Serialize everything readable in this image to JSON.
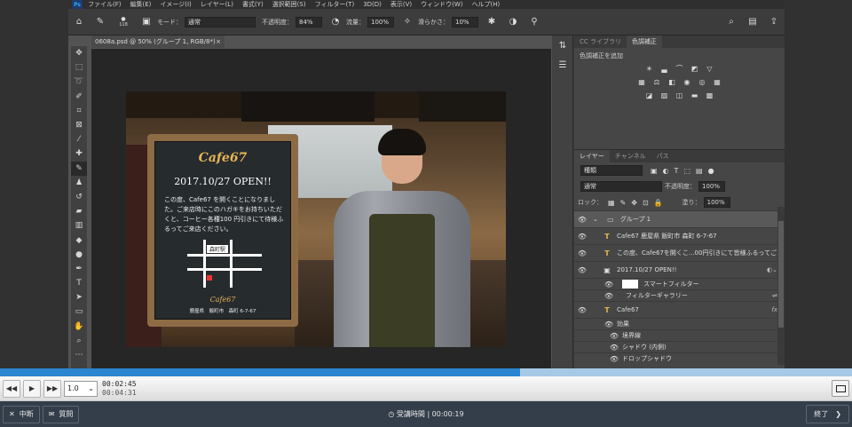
{
  "menu": [
    "ファイル(F)",
    "編集(E)",
    "イメージ(I)",
    "レイヤー(L)",
    "書式(Y)",
    "選択範囲(S)",
    "フィルター(T)",
    "3D(D)",
    "表示(V)",
    "ウィンドウ(W)",
    "ヘルプ(H)"
  ],
  "options": {
    "brush_size": "118",
    "mode_label": "モード：",
    "mode_value": "通常",
    "opacity_label": "不透明度：",
    "opacity_value": "84%",
    "flow_label": "流量：",
    "flow_value": "100%",
    "smooth_label": "滑らかさ：",
    "smooth_value": "10%"
  },
  "document_tab": {
    "title": "0608a.psd @ 50% (グループ 1, RGB/8*)",
    "close": "×"
  },
  "poster": {
    "cafe_title": "Cafe67",
    "open_text": "2017.10/27 OPEN!!",
    "info_text": "この度、Cafe67 を開くことになりました。ご来店時にこのハガキをお持ちいただくと、コーヒー各種100 円引きにて待様ふるってご来店ください。",
    "map_station": "森町駅",
    "cafe_small": "Cafe67",
    "address": "鹿屋県　飯町市　森町 6-7-67"
  },
  "adjust_panel": {
    "tab_library": "CC ライブラリ",
    "tab_adjust": "色調補正",
    "label": "色調補正を追加"
  },
  "layers_panel": {
    "tabs": [
      "レイヤー",
      "チャンネル",
      "パス"
    ],
    "kind_filter": "種類",
    "blend_mode": "通常",
    "opacity_label": "不透明度：",
    "opacity_value": "100%",
    "lock_label": "ロック：",
    "fill_label": "塗り：",
    "fill_value": "100%",
    "rows": [
      {
        "name": "グループ 1",
        "type": "group"
      },
      {
        "name": "Cafe67 鹿屋県 飯町市 森町 6-7-67",
        "type": "text"
      },
      {
        "name": "この度、Cafe67を開くこ...00円引きにて皆様ふるってご",
        "type": "text"
      },
      {
        "name": "2017.10/27 OPEN!!",
        "type": "smart"
      },
      {
        "name": "スマートフィルター",
        "type": "sub"
      },
      {
        "name": "フィルターギャラリー",
        "type": "sub"
      },
      {
        "name": "Cafe67",
        "type": "text",
        "fx": "fx"
      },
      {
        "name": "効果",
        "type": "sub"
      },
      {
        "name": "境界線",
        "type": "sub"
      },
      {
        "name": "シャドウ (内側)",
        "type": "sub"
      },
      {
        "name": "ドロップシャドウ",
        "type": "sub"
      }
    ]
  },
  "player": {
    "speed": "1.0",
    "current_time": "00:02:45",
    "duration": "00:04:31",
    "progress_fraction": 0.61
  },
  "bottom": {
    "stop_label": "中断",
    "question_label": "質問",
    "timer_text": "受講時間 | 00:00:19",
    "end_label": "終了"
  }
}
